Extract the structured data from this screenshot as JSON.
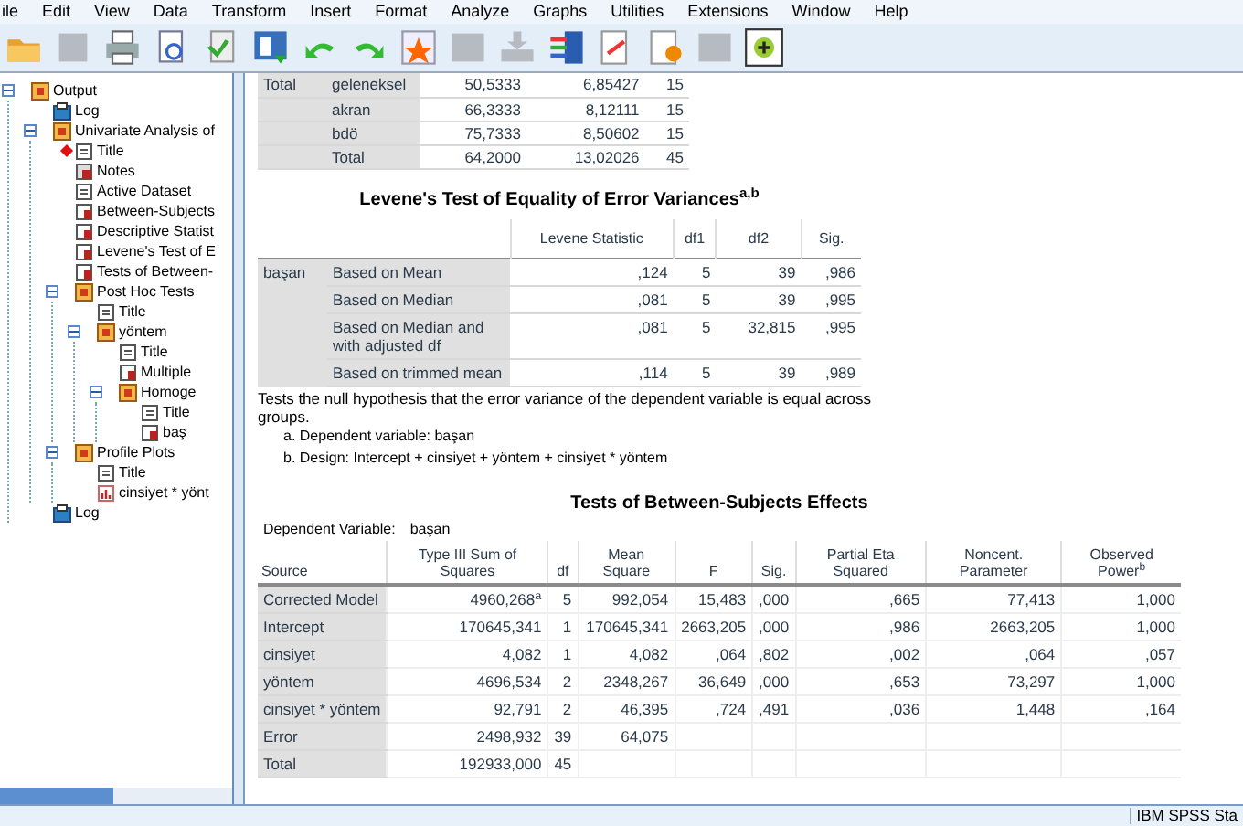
{
  "menu": [
    "ile",
    "Edit",
    "View",
    "Data",
    "Transform",
    "Insert",
    "Format",
    "Analyze",
    "Graphs",
    "Utilities",
    "Extensions",
    "Window",
    "Help"
  ],
  "toolbar": [
    {
      "disabled": false
    },
    {
      "disabled": true
    },
    {
      "disabled": false
    },
    {
      "disabled": false
    },
    {
      "disabled": false
    },
    {
      "disabled": false
    },
    {
      "disabled": false
    },
    {
      "disabled": false
    },
    {
      "disabled": false
    },
    {
      "disabled": true
    },
    {
      "disabled": true
    },
    {
      "disabled": false
    },
    {
      "disabled": false
    },
    {
      "disabled": false
    },
    {
      "disabled": true
    },
    {
      "disabled": false
    }
  ],
  "tree": [
    {
      "label": "Output",
      "kind": "book",
      "expanded": true,
      "current": false,
      "children": [
        {
          "label": "Log",
          "kind": "log",
          "current": false
        },
        {
          "label": "Univariate Analysis of",
          "kind": "book",
          "expanded": true,
          "current": false,
          "children": [
            {
              "label": "Title",
              "kind": "doc",
              "current": true
            },
            {
              "label": "Notes",
              "kind": "hidden",
              "current": false
            },
            {
              "label": "Active Dataset",
              "kind": "doc",
              "current": false
            },
            {
              "label": "Between-Subjects",
              "kind": "table",
              "current": false
            },
            {
              "label": "Descriptive Statist",
              "kind": "table",
              "current": false
            },
            {
              "label": "Levene's Test of E",
              "kind": "table",
              "current": false
            },
            {
              "label": "Tests of Between-",
              "kind": "table",
              "current": false
            },
            {
              "label": "Post Hoc Tests",
              "kind": "book",
              "expanded": true,
              "current": false,
              "children": [
                {
                  "label": "Title",
                  "kind": "doc",
                  "current": false
                },
                {
                  "label": "yöntem",
                  "kind": "book",
                  "expanded": true,
                  "current": false,
                  "children": [
                    {
                      "label": "Title",
                      "kind": "doc",
                      "current": false
                    },
                    {
                      "label": "Multiple",
                      "kind": "table",
                      "current": false
                    },
                    {
                      "label": "Homoge",
                      "kind": "book",
                      "expanded": true,
                      "current": false,
                      "children": [
                        {
                          "label": "Title",
                          "kind": "doc",
                          "current": false
                        },
                        {
                          "label": "baş",
                          "kind": "table",
                          "current": false
                        }
                      ]
                    }
                  ]
                }
              ]
            },
            {
              "label": "Profile Plots",
              "kind": "book",
              "expanded": true,
              "current": false,
              "children": [
                {
                  "label": "Title",
                  "kind": "doc",
                  "current": false
                },
                {
                  "label": "cinsiyet * yönt",
                  "kind": "chart",
                  "current": false
                }
              ]
            }
          ]
        },
        {
          "label": "Log",
          "kind": "log",
          "current": false
        }
      ]
    }
  ],
  "descriptives": {
    "rows": [
      [
        "Total",
        "geleneksel",
        "50,5333",
        "6,85427",
        "15"
      ],
      [
        "",
        "akran",
        "66,3333",
        "8,12111",
        "15"
      ],
      [
        "",
        "bdö",
        "75,7333",
        "8,50602",
        "15"
      ],
      [
        "",
        "Total",
        "64,2000",
        "13,02026",
        "45"
      ]
    ]
  },
  "levene": {
    "title": "Levene's Test of Equality of Error Variances$^{a,b}$",
    "columns": [
      "",
      "",
      "Levene Statistic",
      "df1",
      "df2",
      "Sig."
    ],
    "rows": [
      [
        "başan",
        "Based on Mean",
        ",124",
        "5",
        "39",
        ",986"
      ],
      [
        "",
        "Based on Median",
        ",081",
        "5",
        "39",
        ",995"
      ],
      [
        "",
        "Based on Median and with adjusted df",
        ",081",
        "5",
        "32,815",
        ",995"
      ],
      [
        "",
        "Based on trimmed mean",
        ",114",
        "5",
        "39",
        ",989"
      ]
    ],
    "note": "Tests the null hypothesis that the error variance of the dependent variable is equal across groups.",
    "footnotes": [
      "a. Dependent variable: başan",
      "b. Design: Intercept + cinsiyet + yöntem + cinsiyet * yöntem"
    ]
  },
  "between": {
    "title": "Tests of Between-Subjects Effects",
    "dependent_label": "Dependent Variable:",
    "dependent_value": "başan",
    "columns": [
      "Source",
      "Type III Sum of Squares",
      "df",
      "Mean Square",
      "F",
      "Sig.",
      "Partial Eta Squared",
      "Noncent. Parameter",
      "Observed Power$^{b}$"
    ],
    "rows": [
      [
        "Corrected Model",
        "4960,268$^{a}$",
        "5",
        "992,054",
        "15,483",
        ",000",
        ",665",
        "77,413",
        "1,000"
      ],
      [
        "Intercept",
        "170645,341",
        "1",
        "170645,341",
        "2663,205",
        ",000",
        ",986",
        "2663,205",
        "1,000"
      ],
      [
        "cinsiyet",
        "4,082",
        "1",
        "4,082",
        ",064",
        ",802",
        ",002",
        ",064",
        ",057"
      ],
      [
        "yöntem",
        "4696,534",
        "2",
        "2348,267",
        "36,649",
        ",000",
        ",653",
        "73,297",
        "1,000"
      ],
      [
        "cinsiyet * yöntem",
        "92,791",
        "2",
        "46,395",
        ",724",
        ",491",
        ",036",
        "1,448",
        ",164"
      ],
      [
        "Error",
        "2498,932",
        "39",
        "64,075",
        "",
        "",
        "",
        "",
        ""
      ],
      [
        "Total",
        "192933,000",
        "45",
        "",
        "",
        "",
        "",
        "",
        ""
      ]
    ]
  },
  "status": "IBM SPSS Sta"
}
